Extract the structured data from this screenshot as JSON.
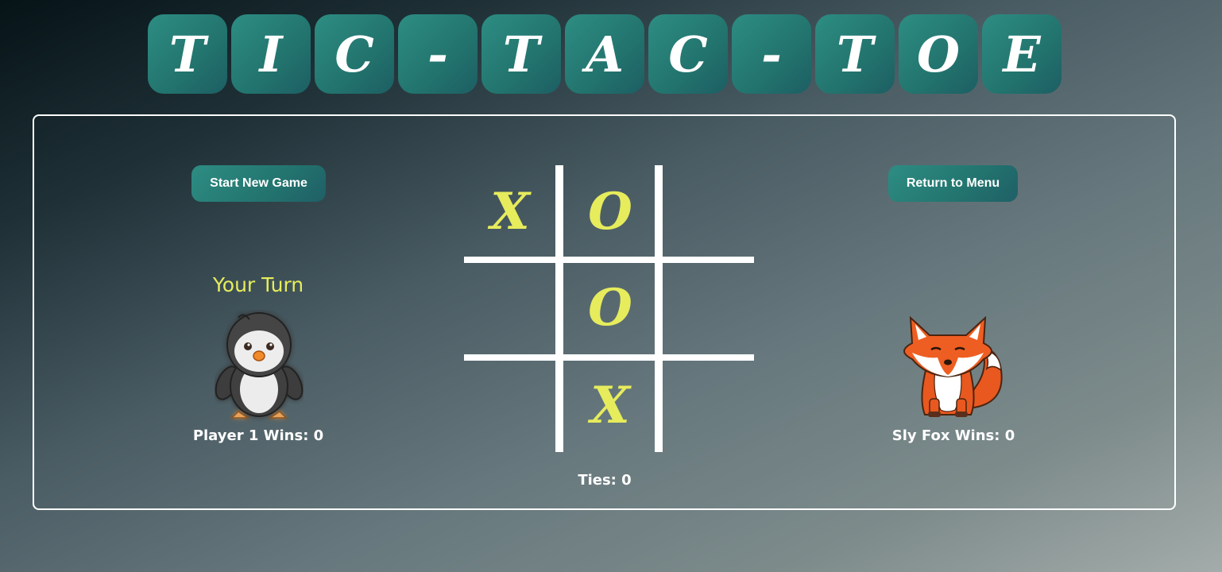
{
  "title": {
    "letters": [
      "T",
      "I",
      "C",
      "-",
      "T",
      "A",
      "C",
      "-",
      "T",
      "O",
      "E"
    ]
  },
  "buttons": {
    "start_new_game": "Start New Game",
    "return_to_menu": "Return to Menu"
  },
  "turn_indicator": "Your Turn",
  "players": {
    "player1": {
      "avatar": "penguin-icon",
      "wins_label": "Player 1 Wins: 0"
    },
    "player2": {
      "avatar": "fox-icon",
      "wins_label": "Sly Fox Wins: 0"
    }
  },
  "ties_label": "Ties: 0",
  "board": {
    "cells": [
      "X",
      "O",
      "",
      "",
      "O",
      "",
      "",
      "X",
      ""
    ]
  },
  "colors": {
    "tile": "#23766f",
    "mark": "#e6ec5c",
    "panel_border": "#ffffff"
  }
}
